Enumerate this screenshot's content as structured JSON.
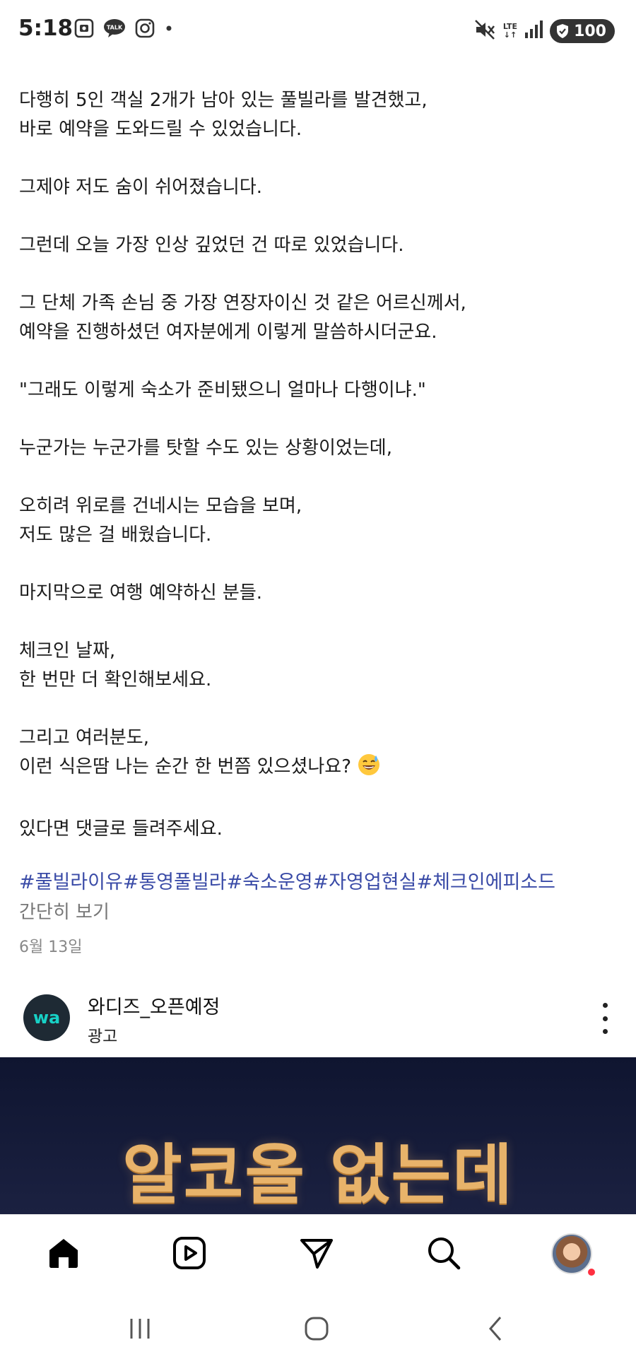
{
  "status": {
    "time": "5:18",
    "network": "LTE",
    "battery": "100",
    "left_icons": [
      "screenshot-icon",
      "kakaotalk-icon",
      "instagram-icon",
      "dot-icon"
    ],
    "right_icons": [
      "mute-icon",
      "lte-icon",
      "signal-icon",
      "battery-icon"
    ]
  },
  "post": {
    "lines": [
      "다행히 5인 객실 2개가 남아 있는 풀빌라를 발견했고,",
      "바로 예약을 도와드릴 수 있었습니다.",
      "",
      "그제야 저도 숨이 쉬어졌습니다.",
      "",
      "그런데 오늘 가장 인상 깊었던 건 따로 있었습니다.",
      "",
      "그 단체 가족 손님 중 가장 연장자이신 것 같은 어르신께서,",
      "예약을 진행하셨던 여자분에게 이렇게 말씀하시더군요.",
      "",
      "\"그래도 이렇게 숙소가 준비됐으니 얼마나 다행이냐.\"",
      "",
      "누군가는 누군가를 탓할 수도 있는 상황이었는데,",
      "",
      "오히려 위로를 건네시는 모습을 보며,",
      "저도 많은 걸 배웠습니다.",
      "",
      "마지막으로 여행 예약하신 분들.",
      "",
      "체크인 날짜,",
      "한 번만 더 확인해보세요.",
      "",
      "그리고 여러분도,",
      "이런 식은땀 나는 순간 한 번쯤 있으셨나요?",
      "",
      "있다면 댓글로 들려주세요."
    ],
    "hashtags": [
      "#풀빌라이유",
      "#통영풀빌라",
      "#숙소운영",
      "#자영업현실",
      "#체크인에피소드"
    ],
    "collapse_label": "간단히 보기",
    "date": "6월 13일"
  },
  "ad": {
    "account_name": "와디즈_오픈예정",
    "sponsored_label": "광고",
    "avatar_text": "wa",
    "headline": "알코올 없는데"
  },
  "nav": {
    "items": [
      "home-icon",
      "reels-icon",
      "direct-message-icon",
      "search-icon",
      "profile-avatar"
    ]
  },
  "colors": {
    "hashtag": "#3a4ba7",
    "ad_banner_bg": "#141a36",
    "ad_headline": "#e8b36a",
    "notification_dot": "#ff3040"
  }
}
